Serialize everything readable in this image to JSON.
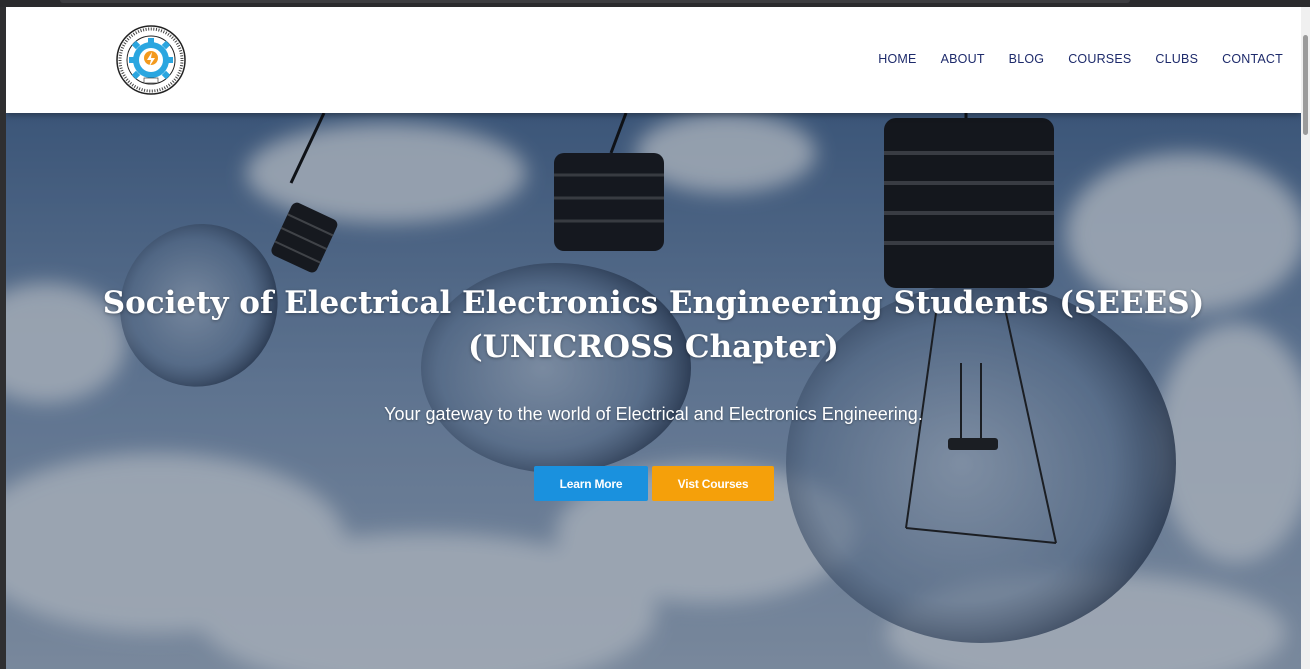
{
  "header": {
    "logo_text": "SOCIETY OF ELECTRICAL & ELECTRONICS ENGINEERING STUDENTS SEEES",
    "nav": [
      "HOME",
      "ABOUT",
      "BLOG",
      "COURSES",
      "CLUBS",
      "CONTACT"
    ]
  },
  "hero": {
    "title_line1": "Society of Electrical Electronics Engineering Students (SEEES)",
    "title_line2": "(UNICROSS Chapter)",
    "subtitle": "Your gateway to the world of Electrical and Electronics Engineering.",
    "learn_more": "Learn More",
    "visit_courses": "Vist Courses"
  },
  "colors": {
    "nav_text": "#1d2a6b",
    "learn_button": "#1a91de",
    "courses_button": "#f5a00a"
  }
}
